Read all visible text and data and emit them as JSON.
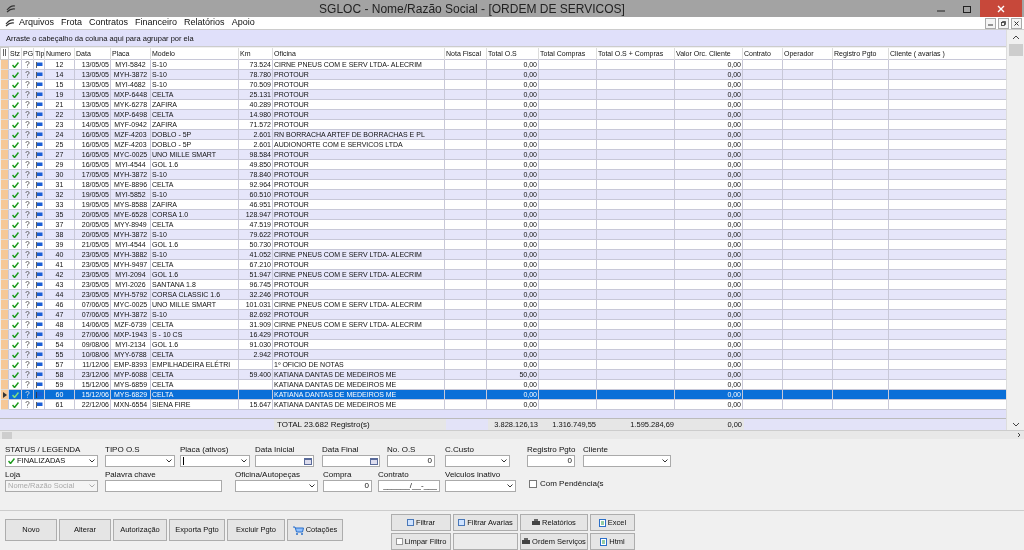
{
  "window": {
    "title": "SGLOC - Nome/Razão Social - [ORDEM DE SERVICOS]"
  },
  "menu": [
    "Arquivos",
    "Frota",
    "Contratos",
    "Financeiro",
    "Relatórios",
    "Apoio"
  ],
  "group_panel": {
    "hint": "Arraste o cabeçalho da coluna aqui para agrupar por ela"
  },
  "table": {
    "columns": [
      "Stz",
      "PG",
      "Tip",
      "Numero",
      "Data",
      "Placa",
      "Modelo",
      "Km",
      "Oficina",
      "Nota Fiscal",
      "Total O.S",
      "Total Compras",
      "Total O.S + Compras",
      "Valor Orc. Cliente",
      "Contrato",
      "Operador",
      "Registro Pgto",
      "Cliente ( avarias )"
    ],
    "rows": [
      {
        "numero": "12",
        "data": "13/05/05",
        "placa": "MYI-5842",
        "modelo": "S-10",
        "km": "73.524",
        "oficina": "CIRNE PNEUS COM E SERV LTDA- ALECRIM",
        "total_os": "0,00",
        "valor_orc_cliente": "0,00",
        "selected": false
      },
      {
        "numero": "14",
        "data": "13/05/05",
        "placa": "MYH-3872",
        "modelo": "S-10",
        "km": "78.780",
        "oficina": "PROTOUR",
        "total_os": "0,00",
        "valor_orc_cliente": "0,00",
        "selected": false
      },
      {
        "numero": "15",
        "data": "13/05/05",
        "placa": "MYI-4682",
        "modelo": "S-10",
        "km": "70.509",
        "oficina": "PROTOUR",
        "total_os": "0,00",
        "valor_orc_cliente": "0,00",
        "selected": false
      },
      {
        "numero": "19",
        "data": "13/05/05",
        "placa": "MXP-6448",
        "modelo": "CELTA",
        "km": "25.131",
        "oficina": "PROTOUR",
        "total_os": "0,00",
        "valor_orc_cliente": "0,00",
        "selected": false
      },
      {
        "numero": "21",
        "data": "13/05/05",
        "placa": "MYK-6278",
        "modelo": "ZAFIRA",
        "km": "40.289",
        "oficina": "PROTOUR",
        "total_os": "0,00",
        "valor_orc_cliente": "0,00",
        "selected": false
      },
      {
        "numero": "22",
        "data": "13/05/05",
        "placa": "MXP-6498",
        "modelo": "CELTA",
        "km": "14.980",
        "oficina": "PROTOUR",
        "total_os": "0,00",
        "valor_orc_cliente": "0,00",
        "selected": false
      },
      {
        "numero": "23",
        "data": "14/05/05",
        "placa": "MYF-0942",
        "modelo": "ZAFIRA",
        "km": "71.572",
        "oficina": "PROTOUR",
        "total_os": "0,00",
        "valor_orc_cliente": "0,00",
        "selected": false
      },
      {
        "numero": "24",
        "data": "16/05/05",
        "placa": "MZF-4203",
        "modelo": "DOBLO - 5P",
        "km": "2.601",
        "oficina": "RN BORRACHA  ARTEF DE BORRACHAS E PL",
        "total_os": "0,00",
        "valor_orc_cliente": "0,00",
        "selected": false
      },
      {
        "numero": "25",
        "data": "16/05/05",
        "placa": "MZF-4203",
        "modelo": "DOBLO - 5P",
        "km": "2.601",
        "oficina": "AUDIONORTE COM E SERVICOS LTDA",
        "total_os": "0,00",
        "valor_orc_cliente": "0,00",
        "selected": false
      },
      {
        "numero": "27",
        "data": "16/05/05",
        "placa": "MYC-0025",
        "modelo": "UNO MILLE SMART",
        "km": "98.584",
        "oficina": "PROTOUR",
        "total_os": "0,00",
        "valor_orc_cliente": "0,00",
        "selected": false
      },
      {
        "numero": "29",
        "data": "16/05/05",
        "placa": "MYI-4544",
        "modelo": "GOL 1.6",
        "km": "49.850",
        "oficina": "PROTOUR",
        "total_os": "0,00",
        "valor_orc_cliente": "0,00",
        "selected": false
      },
      {
        "numero": "30",
        "data": "17/05/05",
        "placa": "MYH-3872",
        "modelo": "S-10",
        "km": "78.840",
        "oficina": "PROTOUR",
        "total_os": "0,00",
        "valor_orc_cliente": "0,00",
        "selected": false
      },
      {
        "numero": "31",
        "data": "18/05/05",
        "placa": "MYE-8896",
        "modelo": "CELTA",
        "km": "92.964",
        "oficina": "PROTOUR",
        "total_os": "0,00",
        "valor_orc_cliente": "0,00",
        "selected": false
      },
      {
        "numero": "32",
        "data": "19/05/05",
        "placa": "MYI-5852",
        "modelo": "S-10",
        "km": "60.510",
        "oficina": "PROTOUR",
        "total_os": "0,00",
        "valor_orc_cliente": "0,00",
        "selected": false
      },
      {
        "numero": "33",
        "data": "19/05/05",
        "placa": "MYS-8588",
        "modelo": "ZAFIRA",
        "km": "46.951",
        "oficina": "PROTOUR",
        "total_os": "0,00",
        "valor_orc_cliente": "0,00",
        "selected": false
      },
      {
        "numero": "35",
        "data": "20/05/05",
        "placa": "MYE-6528",
        "modelo": "CORSA 1.0",
        "km": "128.947",
        "oficina": "PROTOUR",
        "total_os": "0,00",
        "valor_orc_cliente": "0,00",
        "selected": false
      },
      {
        "numero": "37",
        "data": "20/05/05",
        "placa": "MYY-8949",
        "modelo": "CELTA",
        "km": "47.519",
        "oficina": "PROTOUR",
        "total_os": "0,00",
        "valor_orc_cliente": "0,00",
        "selected": false
      },
      {
        "numero": "38",
        "data": "20/05/05",
        "placa": "MYH-3872",
        "modelo": "S-10",
        "km": "79.622",
        "oficina": "PROTOUR",
        "total_os": "0,00",
        "valor_orc_cliente": "0,00",
        "selected": false
      },
      {
        "numero": "39",
        "data": "21/05/05",
        "placa": "MYI-4544",
        "modelo": "GOL 1.6",
        "km": "50.730",
        "oficina": "PROTOUR",
        "total_os": "0,00",
        "valor_orc_cliente": "0,00",
        "selected": false
      },
      {
        "numero": "40",
        "data": "23/05/05",
        "placa": "MYH-3882",
        "modelo": "S-10",
        "km": "41.052",
        "oficina": "CIRNE PNEUS COM E SERV LTDA- ALECRIM",
        "total_os": "0,00",
        "valor_orc_cliente": "0,00",
        "selected": false
      },
      {
        "numero": "41",
        "data": "23/05/05",
        "placa": "MYH-9497",
        "modelo": "CELTA",
        "km": "67.210",
        "oficina": "PROTOUR",
        "total_os": "0,00",
        "valor_orc_cliente": "0,00",
        "selected": false
      },
      {
        "numero": "42",
        "data": "23/05/05",
        "placa": "MYI-2094",
        "modelo": "GOL 1.6",
        "km": "51.947",
        "oficina": "CIRNE PNEUS COM E SERV LTDA- ALECRIM",
        "total_os": "0,00",
        "valor_orc_cliente": "0,00",
        "selected": false
      },
      {
        "numero": "43",
        "data": "23/05/05",
        "placa": "MYI-2026",
        "modelo": "SANTANA 1.8",
        "km": "96.745",
        "oficina": "PROTOUR",
        "total_os": "0,00",
        "valor_orc_cliente": "0,00",
        "selected": false
      },
      {
        "numero": "44",
        "data": "23/05/05",
        "placa": "MYH-5792",
        "modelo": "CORSA CLASSIC 1.6",
        "km": "32.246",
        "oficina": "PROTOUR",
        "total_os": "0,00",
        "valor_orc_cliente": "0,00",
        "selected": false
      },
      {
        "numero": "46",
        "data": "07/06/05",
        "placa": "MYC-0025",
        "modelo": "UNO MILLE SMART",
        "km": "101.031",
        "oficina": "CIRNE PNEUS COM E SERV LTDA- ALECRIM",
        "total_os": "0,00",
        "valor_orc_cliente": "0,00",
        "selected": false
      },
      {
        "numero": "47",
        "data": "07/06/05",
        "placa": "MYH-3872",
        "modelo": "S-10",
        "km": "82.692",
        "oficina": "PROTOUR",
        "total_os": "0,00",
        "valor_orc_cliente": "0,00",
        "selected": false
      },
      {
        "numero": "48",
        "data": "14/06/05",
        "placa": "MZF-6739",
        "modelo": "CELTA",
        "km": "31.909",
        "oficina": "CIRNE PNEUS COM E SERV LTDA- ALECRIM",
        "total_os": "0,00",
        "valor_orc_cliente": "0,00",
        "selected": false
      },
      {
        "numero": "49",
        "data": "27/06/06",
        "placa": "MXP-1943",
        "modelo": "S - 10 CS",
        "km": "16.429",
        "oficina": "PROTOUR",
        "total_os": "0,00",
        "valor_orc_cliente": "0,00",
        "selected": false
      },
      {
        "numero": "54",
        "data": "09/08/06",
        "placa": "MYI-2134",
        "modelo": "GOL 1.6",
        "km": "91.030",
        "oficina": "PROTOUR",
        "total_os": "0,00",
        "valor_orc_cliente": "0,00",
        "selected": false
      },
      {
        "numero": "55",
        "data": "10/08/06",
        "placa": "MYY-6788",
        "modelo": "CELTA",
        "km": "2.942",
        "oficina": "PROTOUR",
        "total_os": "0,00",
        "valor_orc_cliente": "0,00",
        "selected": false
      },
      {
        "numero": "57",
        "data": "11/12/06",
        "placa": "EMP-8393",
        "modelo": "EMPILHADEIRA ELÉTRI",
        "oficina": "1º OFICIO DE NOTAS",
        "total_os": "0,00",
        "valor_orc_cliente": "0,00",
        "selected": false
      },
      {
        "numero": "58",
        "data": "23/12/06",
        "placa": "MYP-6088",
        "modelo": "CELTA",
        "km": "59.400",
        "oficina": "KATIANA DANTAS DE MEDEIROS ME",
        "total_os": "50,00",
        "valor_orc_cliente": "0,00",
        "selected": false
      },
      {
        "numero": "59",
        "data": "15/12/06",
        "placa": "MYS-6859",
        "modelo": "CELTA",
        "oficina": "KATIANA DANTAS DE MEDEIROS ME",
        "total_os": "0,00",
        "valor_orc_cliente": "0,00",
        "selected": false
      },
      {
        "numero": "60",
        "data": "15/12/06",
        "placa": "MYS-6829",
        "modelo": "CELTA",
        "oficina": "KATIANA DANTAS DE MEDEIROS ME",
        "total_os": "0,00",
        "valor_orc_cliente": "0,00",
        "selected": true
      },
      {
        "numero": "61",
        "data": "22/12/06",
        "placa": "MXN-6554",
        "modelo": "SIENA FIRE",
        "km": "15.647",
        "oficina": "KATIANA DANTAS DE MEDEIROS ME",
        "total_os": "0,00",
        "valor_orc_cliente": "0,00",
        "selected": false
      }
    ],
    "totals": {
      "label": "TOTAL 23.682  Registro(s)",
      "total_os": "3.828.126,13",
      "total_compras": "1.316.749,55",
      "total_os_compras": "1.595.284,69",
      "valor_orc_cliente": "0,00"
    }
  },
  "filter_rows": [
    [
      {
        "kind": "select",
        "label": "STATUS / LEGENDA",
        "value": "FINALIZADAS"
      },
      {
        "kind": "select",
        "label": "TIPO O.S"
      },
      {
        "kind": "select",
        "label": "Placa (ativos)",
        "focused": true
      },
      {
        "kind": "date",
        "label": "Data Inicial"
      },
      {
        "kind": "date",
        "label": "Data Final"
      },
      {
        "kind": "input",
        "label": "No. O.S",
        "value": "0"
      },
      {
        "kind": "select",
        "label": "C.Custo"
      },
      {
        "kind": "input",
        "label": "Registro Pgto",
        "value": "0"
      },
      {
        "kind": "select",
        "label": "Cliente"
      }
    ],
    [
      {
        "kind": "select",
        "label": "Loja",
        "placeholder": "Nome/Razão Social",
        "disabled": true
      },
      {
        "kind": "input",
        "label": "Palavra chave"
      },
      {
        "kind": "select",
        "label": "Oficina/Autopeças"
      },
      {
        "kind": "input",
        "label": "Compra",
        "value": "0"
      },
      {
        "kind": "input",
        "label": "Contrato",
        "value": "______/__-___"
      },
      {
        "kind": "select",
        "label": "Veiculos inativo"
      },
      {
        "kind": "checkbox",
        "label": "Com Pendência(s",
        "checked": false
      }
    ]
  ],
  "actions": [
    "Novo",
    "Alterar",
    "Autorização",
    "Exporta Pgto",
    "Excluir Pgto",
    "Cotações"
  ],
  "tools": [
    {
      "label": "Filtrar"
    },
    {
      "label": "Filtrar Avarias"
    },
    {
      "label": "Relatórios"
    },
    {
      "label": "Excel"
    },
    {
      "label": "Limpar Filtro"
    },
    {
      "kind": "blank"
    },
    {
      "label": "Ordem Serviços"
    },
    {
      "label": "Html"
    }
  ]
}
